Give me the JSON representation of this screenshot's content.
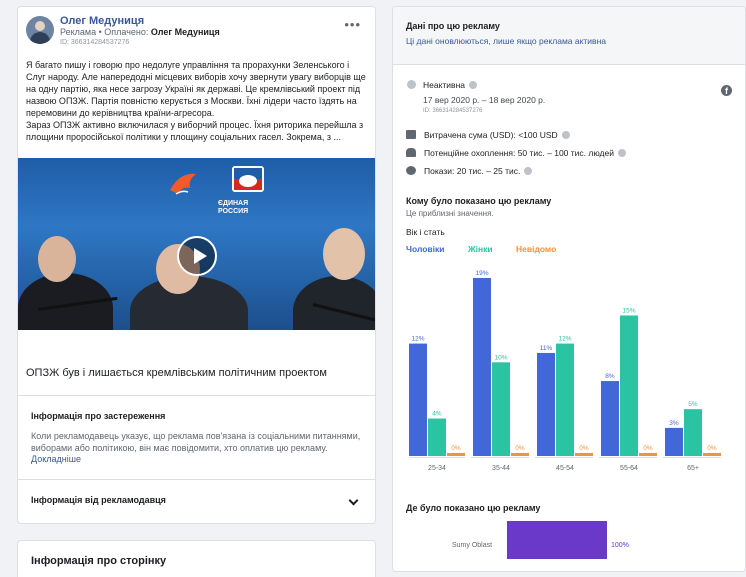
{
  "ad": {
    "page_name": "Олег Медуниця",
    "sponsored_label": "Реклама",
    "paid_by_prefix": "Оплачено:",
    "paid_by": "Олег Медуниця",
    "id_line": "ID: 366314284537276",
    "text_p1": "Я багато пишу і говорю про недолуге управління та прорахунки Зеленського і Слуг народу. Але напередодні місцевих виборів хочу звернути увагу виборців ще на одну партію, яка несе загрозу Україні як державі. Це кремлівський проект під назвою ОПЗЖ. Партія повністю керується з Москви. Їхні лідери часто їздять на перемовини до керівництва країни-агресора.",
    "text_p2": "Зараз ОПЗЖ активно включилася у виборчий процес. Їхня риторика перейшла з площини проросійської політики у площину соціальних гасел. Зокрема, з ...",
    "video_logo_text_1": "ЄДИНАЯ",
    "video_logo_text_2": "РОССИЯ",
    "headline": "ОПЗЖ був і лишається кремлівським політичним проектом",
    "disclaimer_title": "Інформація про застереження",
    "disclaimer_text": "Коли рекламодавець указує, що реклама пов'язана із соціальними питаннями, виборами або політикою, він має повідомити, хто оплатив цю рекламу.",
    "disclaimer_link": "Докладніше",
    "advertiser_info": "Інформація від рекламодавця"
  },
  "page_info": {
    "title": "Інформація про сторінку"
  },
  "info": {
    "title": "Дані про цю рекламу",
    "subtitle": "Ці дані оновлюються, лише якщо реклама активна",
    "status": "Неактивна",
    "dates": "17 вер 2020 р. – 18 вер 2020 р.",
    "id_line": "ID: 366314284537276",
    "fb_icon": "f",
    "spent_label": "Витрачена сума (USD):",
    "spent_value": "<100 USD",
    "reach_label": "Потенційне охоплення:",
    "reach_value": "50 тис. – 100 тис. людей",
    "impressions_label": "Покази:",
    "impressions_value": "20 тис. – 25 тис.",
    "who_title": "Кому було показано цю рекламу",
    "who_sub": "Це приблизні значення.",
    "age_title": "Вік і стать",
    "where_title": "Де було показано цю рекламу",
    "region": "Sumy Oblast",
    "region_pct_label": "100%",
    "region_fraction": 1.0
  },
  "chart_data": {
    "type": "bar",
    "categories": [
      "25-34",
      "35-44",
      "45-54",
      "55-64",
      "65+"
    ],
    "series": [
      {
        "name": "Чоловіки",
        "color": "#4267d6",
        "values": [
          12,
          19,
          11,
          8,
          3
        ]
      },
      {
        "name": "Жінки",
        "color": "#2bc4a3",
        "values": [
          4,
          10,
          12,
          15,
          5
        ]
      },
      {
        "name": "Невідомо",
        "color": "#f7923a",
        "values": [
          0,
          0,
          0,
          0,
          0
        ]
      }
    ],
    "value_suffix": "%",
    "ylim": [
      0,
      19
    ]
  },
  "colors": {
    "accent": "#385898",
    "male": "#4267d6",
    "female": "#2bc4a3",
    "unknown": "#f7923a",
    "region": "#6b39c9"
  }
}
